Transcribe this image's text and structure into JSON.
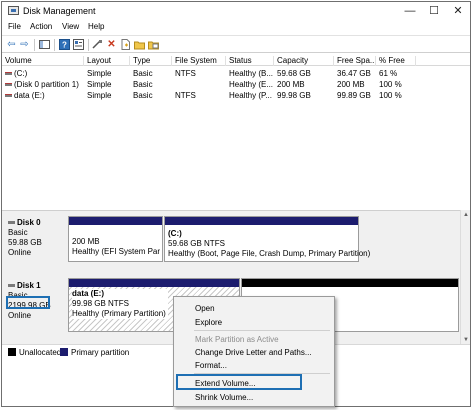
{
  "window": {
    "title": "Disk Management",
    "min": "—",
    "max": "☐",
    "close": "✕"
  },
  "menu": [
    "File",
    "Action",
    "View",
    "Help"
  ],
  "toolbar": {
    "icons": [
      "back-arrow-icon",
      "forward-arrow-icon",
      "console-tree-icon",
      "help-icon",
      "properties-icon",
      "connect-icon",
      "delete-icon",
      "new-icon",
      "open-icon",
      "export-icon"
    ]
  },
  "volume_list": {
    "columns": [
      "Volume",
      "Layout",
      "Type",
      "File System",
      "Status",
      "Capacity",
      "Free Spa...",
      "% Free"
    ],
    "rows": [
      [
        "(C:)",
        "Simple",
        "Basic",
        "NTFS",
        "Healthy (B...",
        "59.68 GB",
        "36.47 GB",
        "61 %"
      ],
      [
        "(Disk 0 partition 1)",
        "Simple",
        "Basic",
        "",
        "Healthy (E...",
        "200 MB",
        "200 MB",
        "100 %"
      ],
      [
        "data (E:)",
        "Simple",
        "Basic",
        "NTFS",
        "Healthy (P...",
        "99.98 GB",
        "99.89 GB",
        "100 %"
      ]
    ]
  },
  "disks": [
    {
      "name": "Disk 0",
      "type": "Basic",
      "size": "59.88 GB",
      "status": "Online",
      "partitions": [
        {
          "name": "",
          "size": "200 MB",
          "status": "Healthy (EFI System Partiti"
        },
        {
          "name": "(C:)",
          "size": "59.68 GB NTFS",
          "status": "Healthy (Boot, Page File, Crash Dump, Primary Partition)"
        }
      ]
    },
    {
      "name": "Disk 1",
      "type": "Basic",
      "size": "2199.98 GB",
      "status": "Online",
      "partitions": [
        {
          "name": "data (E:)",
          "size": "99.98 GB NTFS",
          "status": "Healthy (Primary Partition)"
        }
      ]
    }
  ],
  "legend": [
    {
      "label": "Unallocated",
      "color": "#000000"
    },
    {
      "label": "Primary partition",
      "color": "#1c1c6e"
    }
  ],
  "context_menu": {
    "items": [
      {
        "label": "Open",
        "enabled": true
      },
      {
        "label": "Explore",
        "enabled": true
      },
      {
        "label": "Mark Partition as Active",
        "enabled": false
      },
      {
        "label": "Change Drive Letter and Paths...",
        "enabled": true
      },
      {
        "label": "Format...",
        "enabled": true
      },
      {
        "label": "Extend Volume...",
        "enabled": true
      },
      {
        "label": "Shrink Volume...",
        "enabled": true
      }
    ]
  },
  "colors": {
    "partition_bar": "#1c1c6e",
    "unallocated_bar": "#000000",
    "highlight": "#1e6fb3"
  }
}
